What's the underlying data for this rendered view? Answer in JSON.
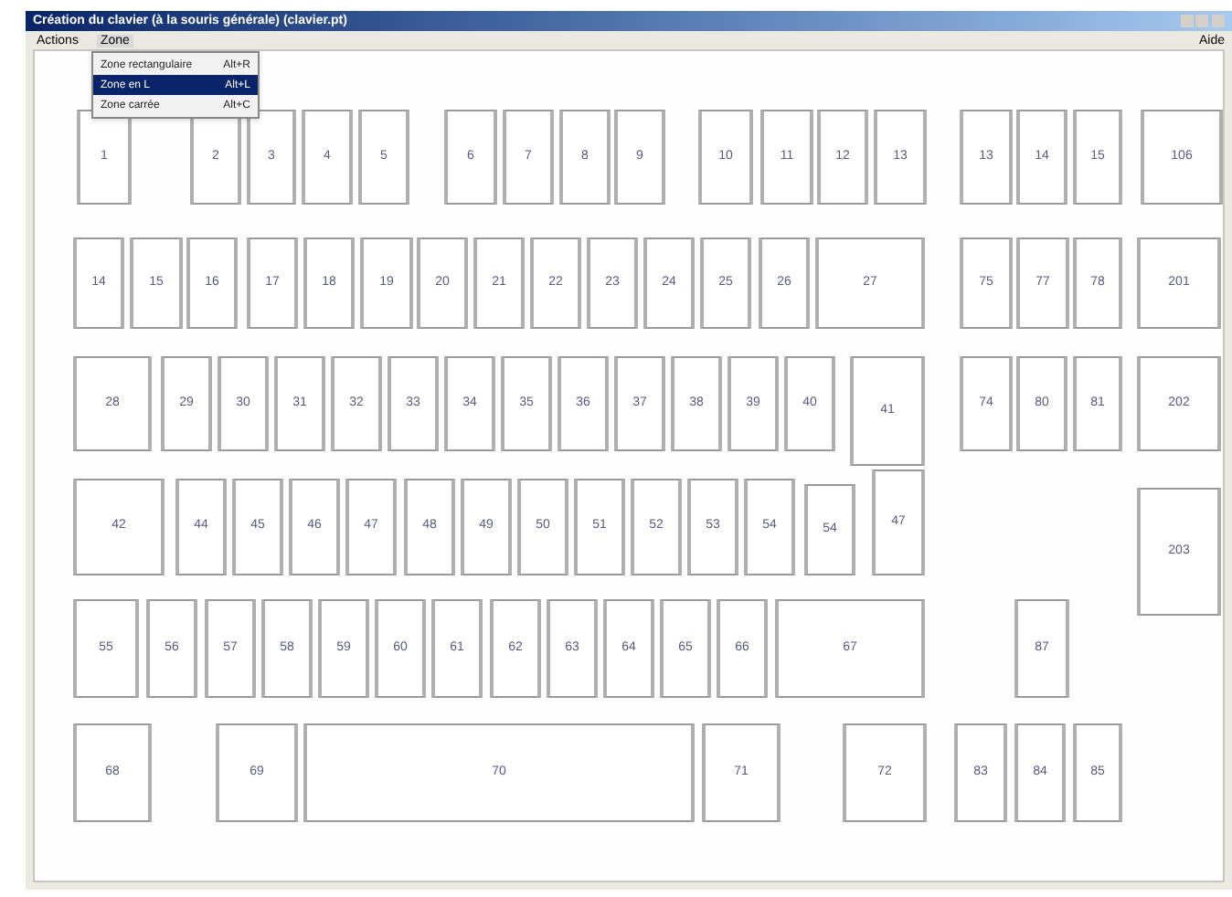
{
  "window": {
    "title": "Création du clavier (à la souris générale) (clavier.pt)"
  },
  "menu_bar": {
    "items": [
      {
        "label": "Actions",
        "selected": false
      },
      {
        "label": "Zone",
        "selected": true
      }
    ],
    "help": "Aide"
  },
  "dropdown": {
    "items": [
      {
        "label": "Zone rectangulaire",
        "shortcut": "Alt+R",
        "selected": false
      },
      {
        "label": "Zone en L",
        "shortcut": "Alt+L",
        "selected": true
      },
      {
        "label": "Zone carrée",
        "shortcut": "Alt+C",
        "selected": false
      }
    ]
  },
  "keyboard": {
    "rows": [
      {
        "keys": [
          {
            "label": "1"
          },
          {
            "label": "2"
          },
          {
            "label": "3"
          },
          {
            "label": "4"
          },
          {
            "label": "5"
          },
          {
            "label": "6"
          },
          {
            "label": "7"
          },
          {
            "label": "8"
          },
          {
            "label": "9"
          },
          {
            "label": "10"
          },
          {
            "label": "11"
          },
          {
            "label": "12"
          },
          {
            "label": "13"
          },
          {
            "label": "13"
          },
          {
            "label": "14"
          },
          {
            "label": "15"
          },
          {
            "label": "106"
          }
        ]
      },
      {
        "keys": [
          {
            "label": "14"
          },
          {
            "label": "15"
          },
          {
            "label": "16"
          },
          {
            "label": "17"
          },
          {
            "label": "18"
          },
          {
            "label": "19"
          },
          {
            "label": "20"
          },
          {
            "label": "21"
          },
          {
            "label": "22"
          },
          {
            "label": "23"
          },
          {
            "label": "24"
          },
          {
            "label": "25"
          },
          {
            "label": "26"
          },
          {
            "label": "27"
          },
          {
            "label": "75"
          },
          {
            "label": "77"
          },
          {
            "label": "78"
          },
          {
            "label": "201"
          }
        ]
      },
      {
        "keys": [
          {
            "label": "28"
          },
          {
            "label": "29"
          },
          {
            "label": "30"
          },
          {
            "label": "31"
          },
          {
            "label": "32"
          },
          {
            "label": "33"
          },
          {
            "label": "34"
          },
          {
            "label": "35"
          },
          {
            "label": "36"
          },
          {
            "label": "37"
          },
          {
            "label": "38"
          },
          {
            "label": "39"
          },
          {
            "label": "40"
          },
          {
            "label": "41"
          },
          {
            "label": "74"
          },
          {
            "label": "80"
          },
          {
            "label": "81"
          },
          {
            "label": "202"
          }
        ]
      },
      {
        "keys": [
          {
            "label": "42"
          },
          {
            "label": "44"
          },
          {
            "label": "45"
          },
          {
            "label": "46"
          },
          {
            "label": "47"
          },
          {
            "label": "48"
          },
          {
            "label": "49"
          },
          {
            "label": "50"
          },
          {
            "label": "51"
          },
          {
            "label": "52"
          },
          {
            "label": "53"
          },
          {
            "label": "54"
          },
          {
            "label": "54"
          },
          {
            "label": "47"
          },
          {
            "label": "203"
          }
        ]
      },
      {
        "keys": [
          {
            "label": "55"
          },
          {
            "label": "56"
          },
          {
            "label": "57"
          },
          {
            "label": "58"
          },
          {
            "label": "59"
          },
          {
            "label": "60"
          },
          {
            "label": "61"
          },
          {
            "label": "62"
          },
          {
            "label": "63"
          },
          {
            "label": "64"
          },
          {
            "label": "65"
          },
          {
            "label": "66"
          },
          {
            "label": "67"
          },
          {
            "label": "87"
          }
        ]
      },
      {
        "keys": [
          {
            "label": "68"
          },
          {
            "label": "69"
          },
          {
            "label": "70"
          },
          {
            "label": "71"
          },
          {
            "label": "72"
          },
          {
            "label": "83"
          },
          {
            "label": "84"
          },
          {
            "label": "85"
          }
        ]
      }
    ]
  }
}
